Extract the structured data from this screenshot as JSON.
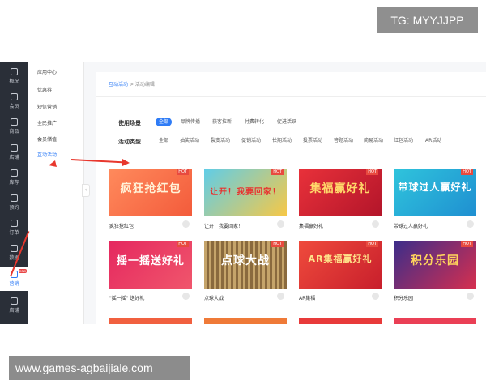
{
  "watermark_top": "TG: MYYJJPP",
  "watermark_bottom": "www.games-agbaijiale.com",
  "sidebar": {
    "items": [
      {
        "label": "概况"
      },
      {
        "label": "会员"
      },
      {
        "label": "商品"
      },
      {
        "label": "店铺"
      },
      {
        "label": "库存"
      },
      {
        "label": "预约"
      },
      {
        "label": "订单"
      },
      {
        "label": "数据"
      },
      {
        "label": "营销",
        "badge": "new"
      },
      {
        "label": "店铺"
      }
    ]
  },
  "subnav": {
    "items": [
      {
        "label": "应用中心"
      },
      {
        "label": "优惠券"
      },
      {
        "label": "短信营销"
      },
      {
        "label": "全民推广"
      },
      {
        "label": "会员储值"
      },
      {
        "label": "互动活动"
      }
    ]
  },
  "breadcrumb": {
    "link": "互动活动",
    "sep": ">",
    "current": "活动编辑"
  },
  "filters": {
    "scene_label": "使用场景",
    "scene_options": [
      "全部",
      "品牌传播",
      "获客拉新",
      "付费转化",
      "促进活跃"
    ],
    "type_label": "活动类型",
    "type_options": [
      "全部",
      "抽奖活动",
      "裂变活动",
      "促销活动",
      "长期活动",
      "投票活动",
      "答题活动",
      "简易活动",
      "红包活动",
      "AR活动"
    ]
  },
  "cards": [
    {
      "thumb_text": "疯狂抢红包",
      "title": "疯狂抢红包",
      "hot": "HOT"
    },
    {
      "thumb_text": "让开！我要回家！",
      "title": "让开！我要回家！",
      "hot": "HOT"
    },
    {
      "thumb_text": "集福赢好礼",
      "title": "集福赢好礼",
      "hot": "HOT"
    },
    {
      "thumb_text": "带球过人赢好礼",
      "title": "带球过人赢好礼",
      "hot": "HOT"
    },
    {
      "thumb_text": "摇一摇送好礼",
      "title": "\"摇一摇\" 送好礼",
      "hot": "HOT"
    },
    {
      "thumb_text": "点球大战",
      "title": "点球大战",
      "hot": "HOT"
    },
    {
      "thumb_text": "AR集福赢好礼",
      "title": "AR集福",
      "hot": "HOT"
    },
    {
      "thumb_text": "积分乐园",
      "title": "积分乐园",
      "hot": "HOT"
    }
  ],
  "colors": {
    "accent": "#2f7cf6",
    "sidebar_bg": "#2a2f38",
    "hot": "#e84a3f",
    "arrow": "#e8372d"
  }
}
